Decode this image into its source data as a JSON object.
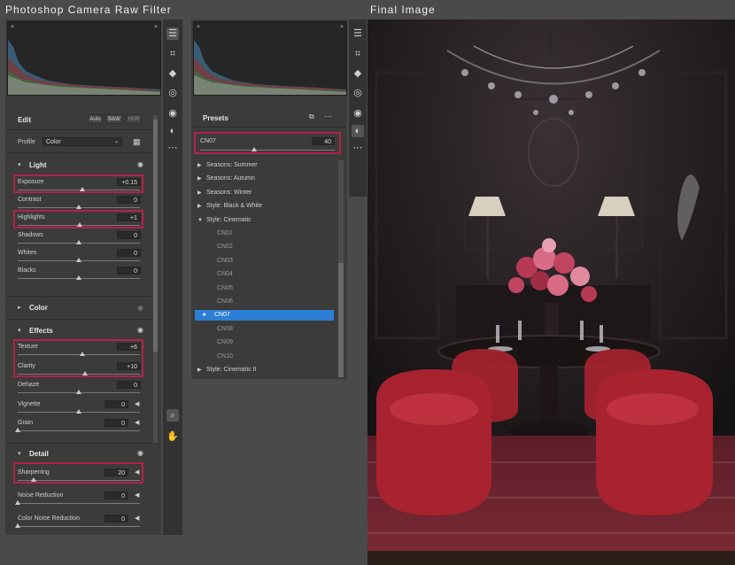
{
  "captions": {
    "left": "Photoshop Camera Raw Filter",
    "right": "Final Image"
  },
  "edit_panel": {
    "title": "Edit",
    "buttons": [
      "Auto",
      "B&W",
      "HDR"
    ],
    "profile_label": "Profile",
    "profile_value": "Color",
    "light": {
      "title": "Light",
      "sliders": [
        {
          "label": "Exposure",
          "value": "+0.15",
          "pos": 0.53
        },
        {
          "label": "Contrast",
          "value": "0",
          "pos": 0.5
        },
        {
          "label": "Highlights",
          "value": "+1",
          "pos": 0.505
        },
        {
          "label": "Shadows",
          "value": "0",
          "pos": 0.5
        },
        {
          "label": "Whites",
          "value": "0",
          "pos": 0.5
        },
        {
          "label": "Blacks",
          "value": "0",
          "pos": 0.5
        }
      ]
    },
    "color": {
      "title": "Color"
    },
    "effects": {
      "title": "Effects",
      "sliders": [
        {
          "label": "Texture",
          "value": "+6",
          "pos": 0.53
        },
        {
          "label": "Clarity",
          "value": "+10",
          "pos": 0.55
        },
        {
          "label": "Dehaze",
          "value": "0",
          "pos": 0.5
        },
        {
          "label": "Vignette",
          "value": "0",
          "pos": 0.5
        },
        {
          "label": "Grain",
          "value": "0",
          "pos": 0.0
        }
      ]
    },
    "detail": {
      "title": "Detail",
      "sliders": [
        {
          "label": "Sharpening",
          "value": "20",
          "pos": 0.13
        },
        {
          "label": "Noise Reduction",
          "value": "0",
          "pos": 0.0
        },
        {
          "label": "Color Noise Reduction",
          "value": "0",
          "pos": 0.0
        }
      ]
    }
  },
  "presets_panel": {
    "title": "Presets",
    "amount_label": "CN07",
    "amount_value": "40",
    "amount_pos": 0.4,
    "items": [
      {
        "label": "Seasons: Summer",
        "type": "group",
        "expanded": false
      },
      {
        "label": "Seasons: Autumn",
        "type": "group",
        "expanded": false
      },
      {
        "label": "Seasons: Winter",
        "type": "group",
        "expanded": false
      },
      {
        "label": "Style: Black & White",
        "type": "group",
        "expanded": false
      },
      {
        "label": "Style: Cinematic",
        "type": "group",
        "expanded": true
      },
      {
        "label": "CN01",
        "type": "preset"
      },
      {
        "label": "CN02",
        "type": "preset"
      },
      {
        "label": "CN03",
        "type": "preset"
      },
      {
        "label": "CN04",
        "type": "preset"
      },
      {
        "label": "CN05",
        "type": "preset"
      },
      {
        "label": "CN06",
        "type": "preset"
      },
      {
        "label": "CN07",
        "type": "preset",
        "selected": true
      },
      {
        "label": "CN08",
        "type": "preset"
      },
      {
        "label": "CN09",
        "type": "preset"
      },
      {
        "label": "CN10",
        "type": "preset"
      },
      {
        "label": "Style: Cinematic II",
        "type": "group",
        "expanded": false
      }
    ]
  },
  "icons": {
    "edit": "sliders-icon",
    "crop": "crop-icon",
    "heal": "eraser-icon",
    "mask": "mask-icon",
    "redeye": "eye-icon",
    "presets": "presets-icon",
    "more": "more-icon",
    "zoom": "zoom-icon",
    "hand": "hand-icon"
  },
  "colors": {
    "highlight": "#b0234a",
    "selection": "#2d7fd6",
    "panel": "#3b3b3b"
  }
}
